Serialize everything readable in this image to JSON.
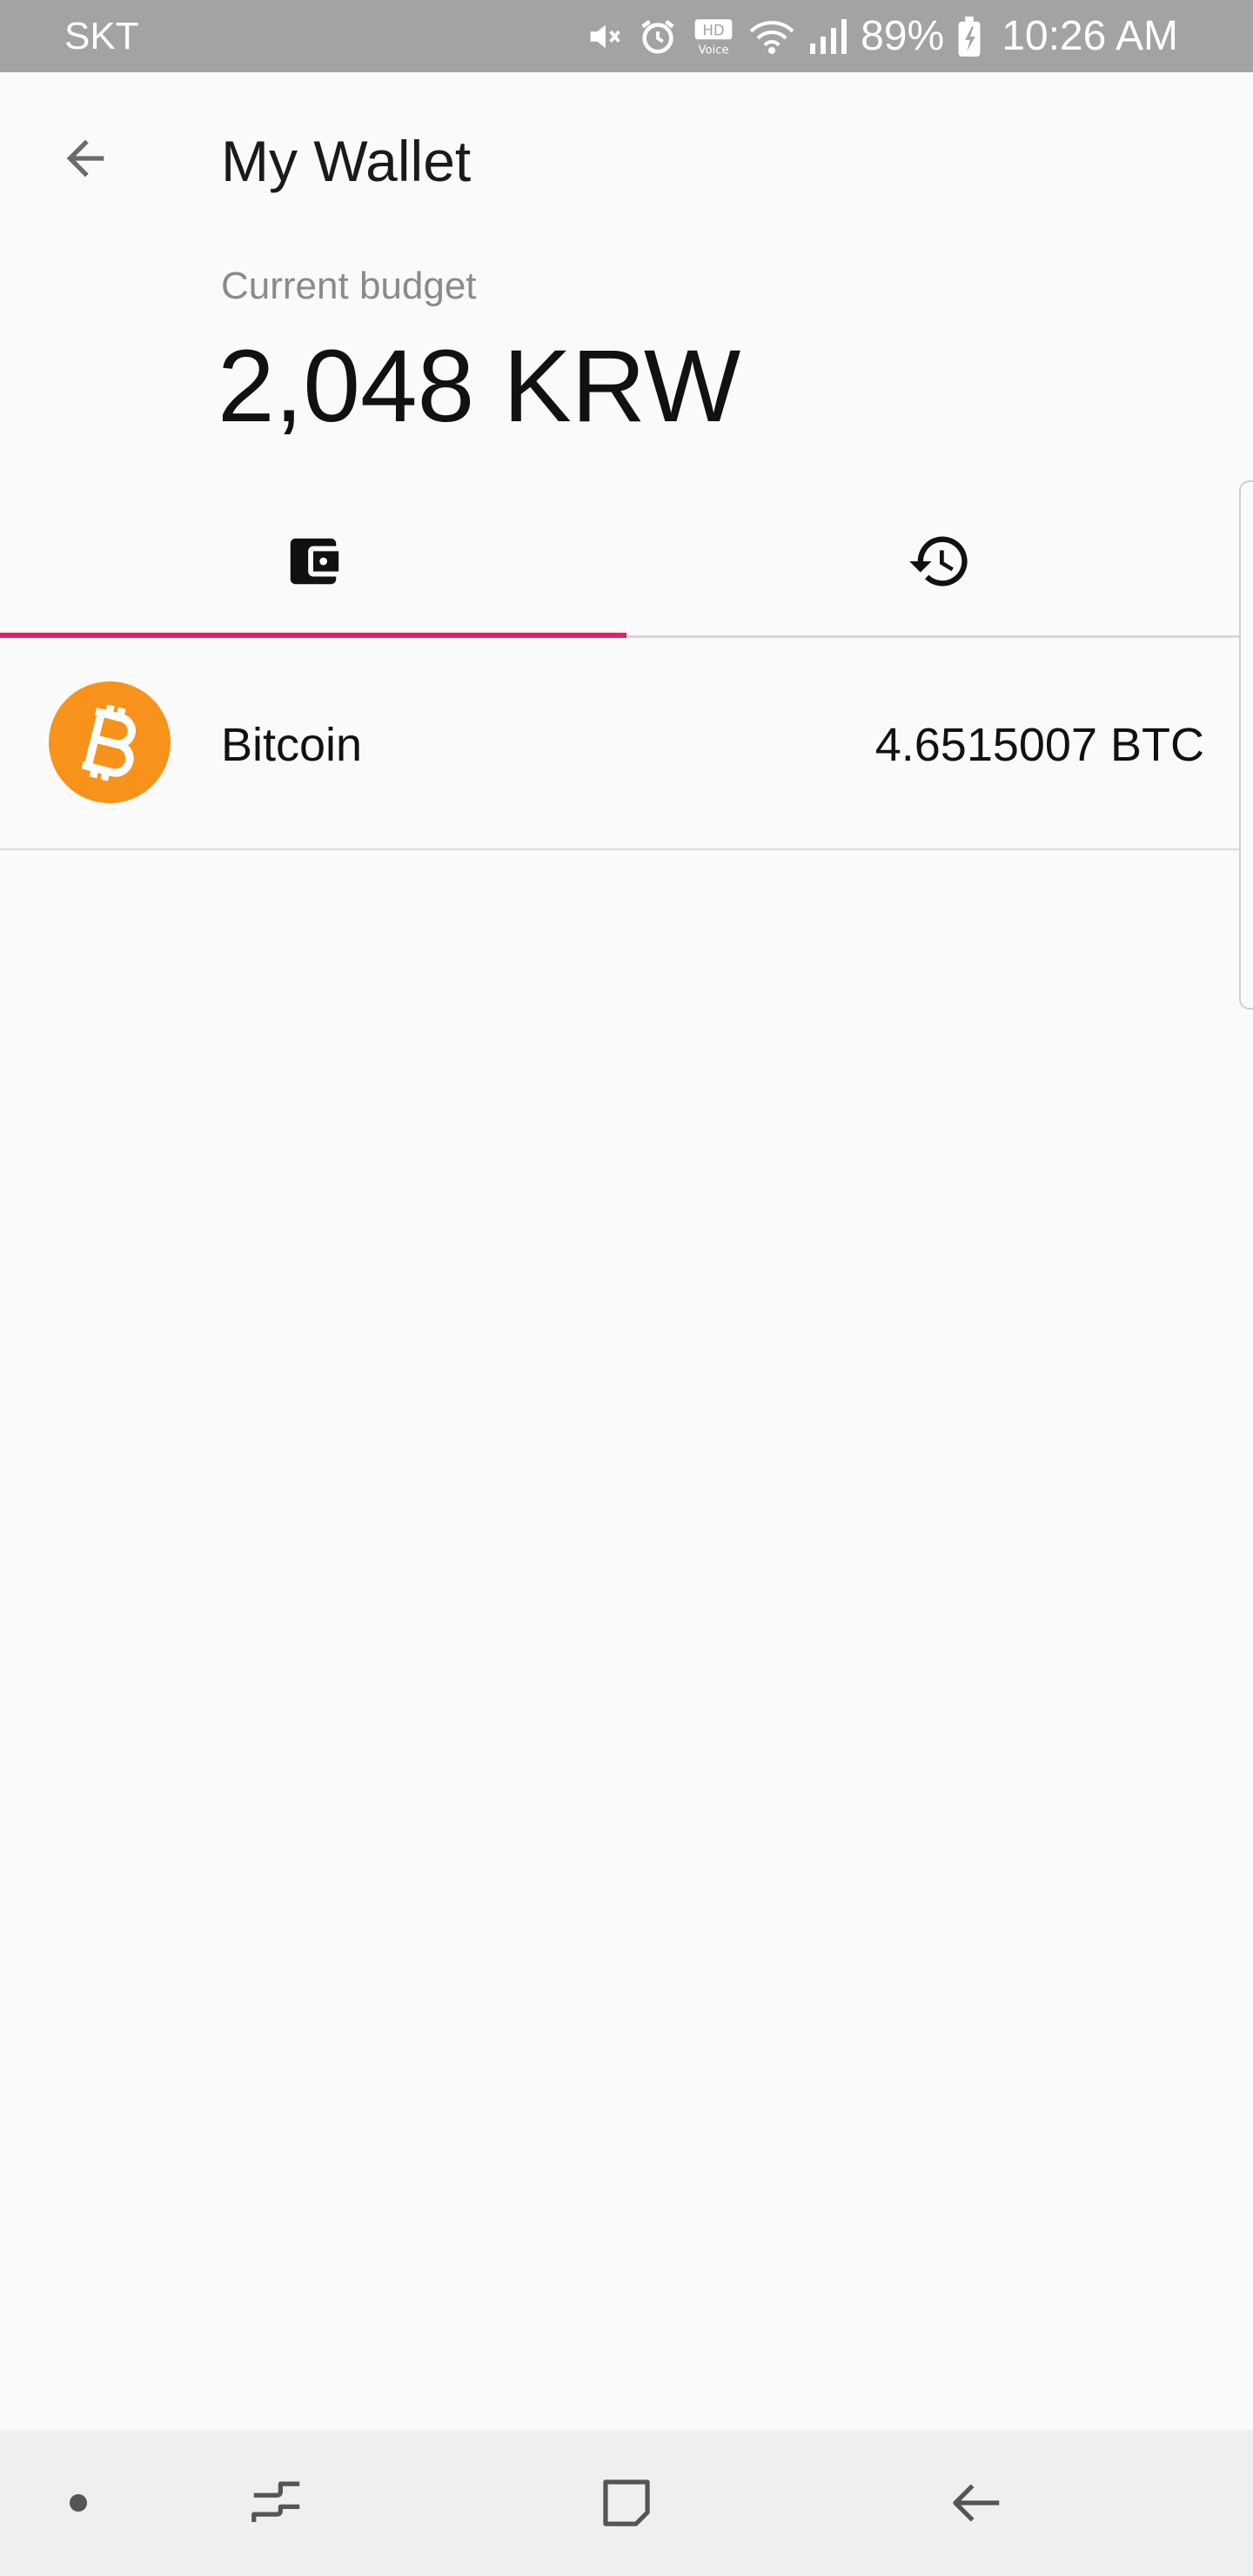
{
  "status_bar": {
    "carrier": "SKT",
    "battery_percent": "89%",
    "time": "10:26 AM",
    "icons": [
      "mute-icon",
      "alarm-icon",
      "hd-voice-icon",
      "wifi-icon",
      "signal-icon",
      "battery-charging-icon"
    ],
    "hd_label": "HD",
    "voice_label": "Voice"
  },
  "header": {
    "title": "My Wallet",
    "back_icon": "arrow-back-icon"
  },
  "budget": {
    "label": "Current budget",
    "value": "2,048 KRW"
  },
  "tabs": [
    {
      "icon": "wallet-icon",
      "selected": true
    },
    {
      "icon": "history-icon",
      "selected": false
    }
  ],
  "coins": [
    {
      "icon": "bitcoin-icon",
      "name": "Bitcoin",
      "amount": "4.6515007 BTC"
    }
  ],
  "nav_bar": {
    "buttons": [
      "nav-dot-icon",
      "recent-apps-icon",
      "home-icon",
      "back-icon"
    ]
  },
  "colors": {
    "accent": "#e91e63",
    "bitcoin": "#f7931a",
    "status_bar": "#a3a3a3",
    "background": "#fafafa"
  }
}
